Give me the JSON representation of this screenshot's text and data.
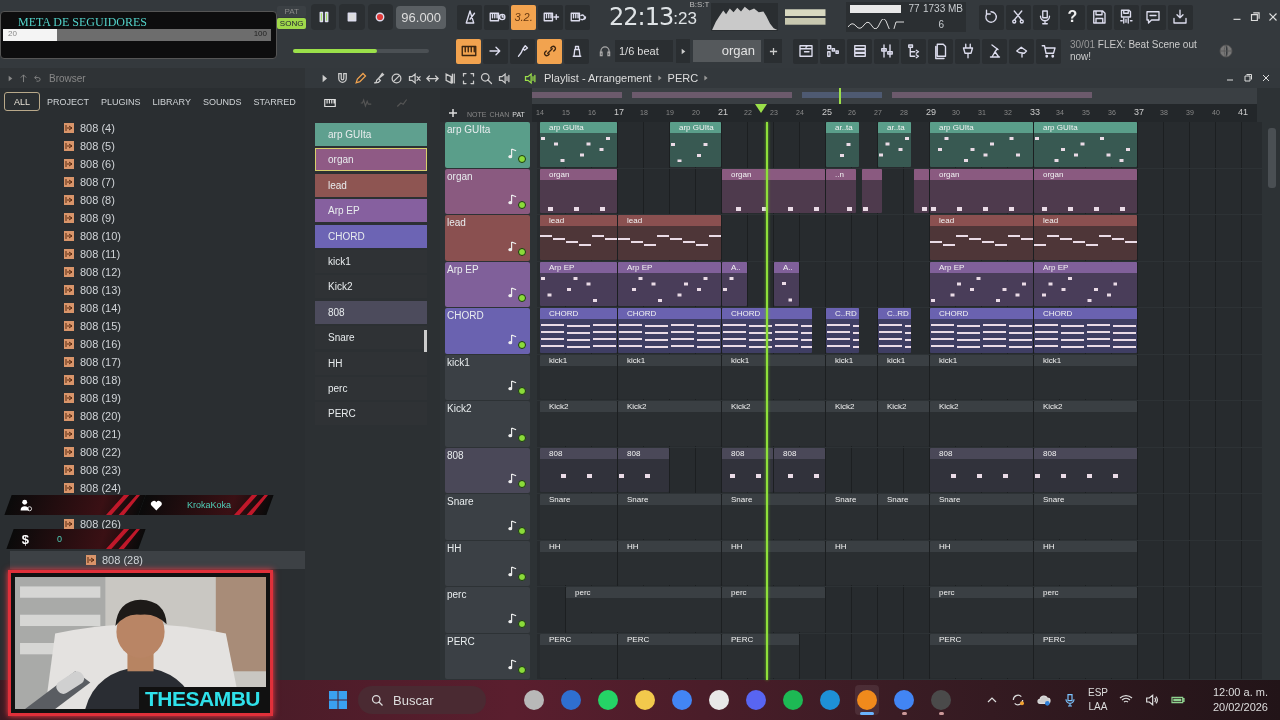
{
  "stream_goal": {
    "title": "META DE SEGUIDORES",
    "current": "20",
    "target": "100",
    "level": 0.2
  },
  "alerts": [
    {
      "kind": "follower"
    },
    {
      "kind": "heart",
      "name": "KrokaKoka"
    },
    {
      "kind": "tip",
      "symbol": "$",
      "amount": "0"
    }
  ],
  "webcam": {
    "kind": "picture",
    "name": "THESAMBU"
  },
  "transport": {
    "modes": [
      {
        "label": "PAT",
        "selected": false
      },
      {
        "label": "SONG",
        "selected": true
      }
    ],
    "playing": true,
    "tempo": "96.000"
  },
  "top_toggles": [
    {
      "on": false
    },
    {
      "on": false
    },
    {
      "label": "3.2.",
      "on": true
    },
    {
      "on": false
    },
    {
      "on": false
    }
  ],
  "time": {
    "main": "22:13",
    "sub": ":23",
    "format": "B:S:T"
  },
  "monitor": {
    "cpu": "77",
    "memory": "1733 MB",
    "polyphony": "6",
    "level": 0.9
  },
  "help_button": "?",
  "master_volume": {
    "level": 0.62
  },
  "mode_toggles": [
    {
      "on": true
    },
    {
      "on": false
    },
    {
      "on": false
    },
    {
      "on": true
    },
    {
      "on": false
    }
  ],
  "snap": "1/6 beat",
  "pattern": "organ",
  "news": {
    "date": "30/01",
    "text": "FLEX: Beat Scene out now!"
  },
  "browser": {
    "title": "Browser",
    "tabs": [
      {
        "label": "ALL",
        "selected": true
      },
      {
        "label": "PROJECT",
        "selected": false
      },
      {
        "label": "PLUGINS",
        "selected": false
      },
      {
        "label": "LIBRARY",
        "selected": false
      },
      {
        "label": "SOUNDS",
        "selected": false
      },
      {
        "label": "STARRED",
        "selected": false
      }
    ],
    "items": [
      {
        "label": "808 (4)",
        "selected": false
      },
      {
        "label": "808 (5)",
        "selected": false
      },
      {
        "label": "808 (6)",
        "selected": false
      },
      {
        "label": "808 (7)",
        "selected": false
      },
      {
        "label": "808 (8)",
        "selected": false
      },
      {
        "label": "808 (9)",
        "selected": false
      },
      {
        "label": "808 (10)",
        "selected": false
      },
      {
        "label": "808 (11)",
        "selected": false
      },
      {
        "label": "808 (12)",
        "selected": false
      },
      {
        "label": "808 (13)",
        "selected": false
      },
      {
        "label": "808 (14)",
        "selected": false
      },
      {
        "label": "808 (15)",
        "selected": false
      },
      {
        "label": "808 (16)",
        "selected": false
      },
      {
        "label": "808 (17)",
        "selected": false
      },
      {
        "label": "808 (18)",
        "selected": false
      },
      {
        "label": "808 (19)",
        "selected": false
      },
      {
        "label": "808 (20)",
        "selected": false
      },
      {
        "label": "808 (21)",
        "selected": false
      },
      {
        "label": "808 (22)",
        "selected": false
      },
      {
        "label": "808 (23)",
        "selected": false
      },
      {
        "label": "808 (24)",
        "selected": false
      },
      {
        "label": "808 (26)",
        "selected": false
      },
      {
        "label": "808 (28)",
        "selected": true
      }
    ]
  },
  "picker": [
    {
      "label": "arp GUIta",
      "color": "#5fa08f",
      "selected": false
    },
    {
      "label": "organ",
      "color": "#8f5a85",
      "selected": true
    },
    {
      "label": "lead",
      "color": "#8e5552",
      "selected": false
    },
    {
      "label": "Arp EP",
      "color": "#86609f",
      "selected": false
    },
    {
      "label": "CHORD",
      "color": "#6c64b4",
      "selected": false
    },
    {
      "label": "kick1",
      "color": "#2f3235",
      "selected": false
    },
    {
      "label": "Kick2",
      "color": "#2f3235",
      "selected": false
    },
    {
      "label": "808",
      "color": "#4c4b5c",
      "selected": false
    },
    {
      "label": "Snare",
      "color": "#2f3235",
      "selected": false
    },
    {
      "label": "HH",
      "color": "#2f3235",
      "selected": false
    },
    {
      "label": "perc",
      "color": "#2f3235",
      "selected": false
    },
    {
      "label": "PERC",
      "color": "#2f3235",
      "selected": false
    }
  ],
  "playlist": {
    "title": "Playlist - Arrangement",
    "breadcrumb": "PERC",
    "header_tabs": [
      "NOTE",
      "CHAN",
      "PAT"
    ],
    "ruler": [
      "14",
      "15",
      "16",
      "17",
      "18",
      "19",
      "20",
      "21",
      "22",
      "23",
      "24",
      "25",
      "26",
      "27",
      "28",
      "29",
      "30",
      "31",
      "32",
      "33",
      "34",
      "35",
      "36",
      "37",
      "38",
      "39",
      "40",
      "41"
    ],
    "tracks": [
      {
        "name": "arp GUIta",
        "color": "#5a9e8a",
        "kind": "dots",
        "enabled": true,
        "clips": [
          {
            "label": "arp GUIta"
          },
          {
            "label": "arp GUIta"
          },
          {
            "label": "ar..ta"
          },
          {
            "label": "ar..ta"
          },
          {
            "label": "arp GUIta"
          },
          {
            "label": "arp GUIta"
          }
        ]
      },
      {
        "name": "organ",
        "color": "#8a5a80",
        "kind": "blocks",
        "enabled": true,
        "clips": [
          {
            "label": "organ"
          },
          {
            "label": "organ"
          },
          {
            "label": "..n"
          },
          {
            "label": "organ"
          },
          {
            "label": "organ"
          }
        ]
      },
      {
        "name": "lead",
        "color": "#8a5050",
        "kind": "lines",
        "enabled": true,
        "clips": [
          {
            "label": "lead"
          },
          {
            "label": "lead"
          },
          {
            "label": "lead"
          },
          {
            "label": "lead"
          }
        ]
      },
      {
        "name": "Arp EP",
        "color": "#80609a",
        "kind": "dots",
        "enabled": true,
        "clips": [
          {
            "label": "Arp EP"
          },
          {
            "label": "Arp EP"
          },
          {
            "label": "A.."
          },
          {
            "label": "A.."
          },
          {
            "label": "Arp EP"
          },
          {
            "label": "Arp EP"
          }
        ]
      },
      {
        "name": "CHORD",
        "color": "#6a62b0",
        "kind": "chords",
        "enabled": true,
        "clips": [
          {
            "label": "CHORD"
          },
          {
            "label": "CHORD"
          },
          {
            "label": "CHORD"
          },
          {
            "label": "C..RD"
          },
          {
            "label": "C..RD"
          },
          {
            "label": "CHORD"
          },
          {
            "label": "CHORD"
          }
        ]
      },
      {
        "name": "kick1",
        "color": "#3b4045",
        "kind": "drums",
        "enabled": true,
        "clips": [
          {
            "label": "kick1"
          },
          {
            "label": "kick1"
          },
          {
            "label": "kick1"
          },
          {
            "label": "kick1"
          },
          {
            "label": "kick1"
          },
          {
            "label": "kick1"
          },
          {
            "label": "kick1"
          }
        ]
      },
      {
        "name": "Kick2",
        "color": "#3b4045",
        "kind": "drums",
        "enabled": true,
        "clips": [
          {
            "label": "Kick2"
          },
          {
            "label": "Kick2"
          },
          {
            "label": "Kick2"
          },
          {
            "label": "Kick2"
          },
          {
            "label": "Kick2"
          },
          {
            "label": "Kick2"
          },
          {
            "label": "Kick2"
          }
        ]
      },
      {
        "name": "808",
        "color": "#4a4858",
        "kind": "blocks",
        "enabled": true,
        "clips": [
          {
            "label": "808"
          },
          {
            "label": "808"
          },
          {
            "label": "808"
          },
          {
            "label": "808"
          },
          {
            "label": "808"
          },
          {
            "label": "808"
          }
        ]
      },
      {
        "name": "Snare",
        "color": "#3b4045",
        "kind": "drums",
        "enabled": true,
        "clips": [
          {
            "label": "Snare"
          },
          {
            "label": "Snare"
          },
          {
            "label": "Snare"
          },
          {
            "label": "Snare"
          },
          {
            "label": "Snare"
          },
          {
            "label": "Snare"
          },
          {
            "label": "Snare"
          }
        ]
      },
      {
        "name": "HH",
        "color": "#3b4045",
        "kind": "drums",
        "enabled": true,
        "clips": [
          {
            "label": "HH"
          },
          {
            "label": "HH"
          },
          {
            "label": "HH"
          },
          {
            "label": "HH"
          },
          {
            "label": "HH"
          },
          {
            "label": "HH"
          }
        ]
      },
      {
        "name": "perc",
        "color": "#3b4045",
        "kind": "drums",
        "enabled": true,
        "clips": [
          {
            "label": "perc"
          },
          {
            "label": "perc"
          },
          {
            "label": "perc"
          },
          {
            "label": "perc"
          }
        ]
      },
      {
        "name": "PERC",
        "color": "#3b4045",
        "kind": "drums",
        "enabled": true,
        "clips": [
          {
            "label": "PERC"
          },
          {
            "label": "PERC"
          },
          {
            "label": "PERC"
          },
          {
            "label": "PERC"
          },
          {
            "label": "PERC"
          }
        ]
      }
    ]
  },
  "taskbar": {
    "search": "Buscar",
    "apps": [
      {
        "running": false,
        "active": false
      },
      {
        "running": false,
        "active": false
      },
      {
        "running": false,
        "active": false
      },
      {
        "running": false,
        "active": false
      },
      {
        "running": false,
        "active": false
      },
      {
        "running": false,
        "active": false
      },
      {
        "running": false,
        "active": false
      },
      {
        "running": false,
        "active": false
      },
      {
        "running": false,
        "active": false
      },
      {
        "running": true,
        "active": true
      },
      {
        "running": true,
        "active": false
      },
      {
        "running": true,
        "active": false
      }
    ],
    "language": "ESP",
    "layout": "LAA",
    "time": "12:00 a. m.",
    "date": "20/02/2026"
  }
}
